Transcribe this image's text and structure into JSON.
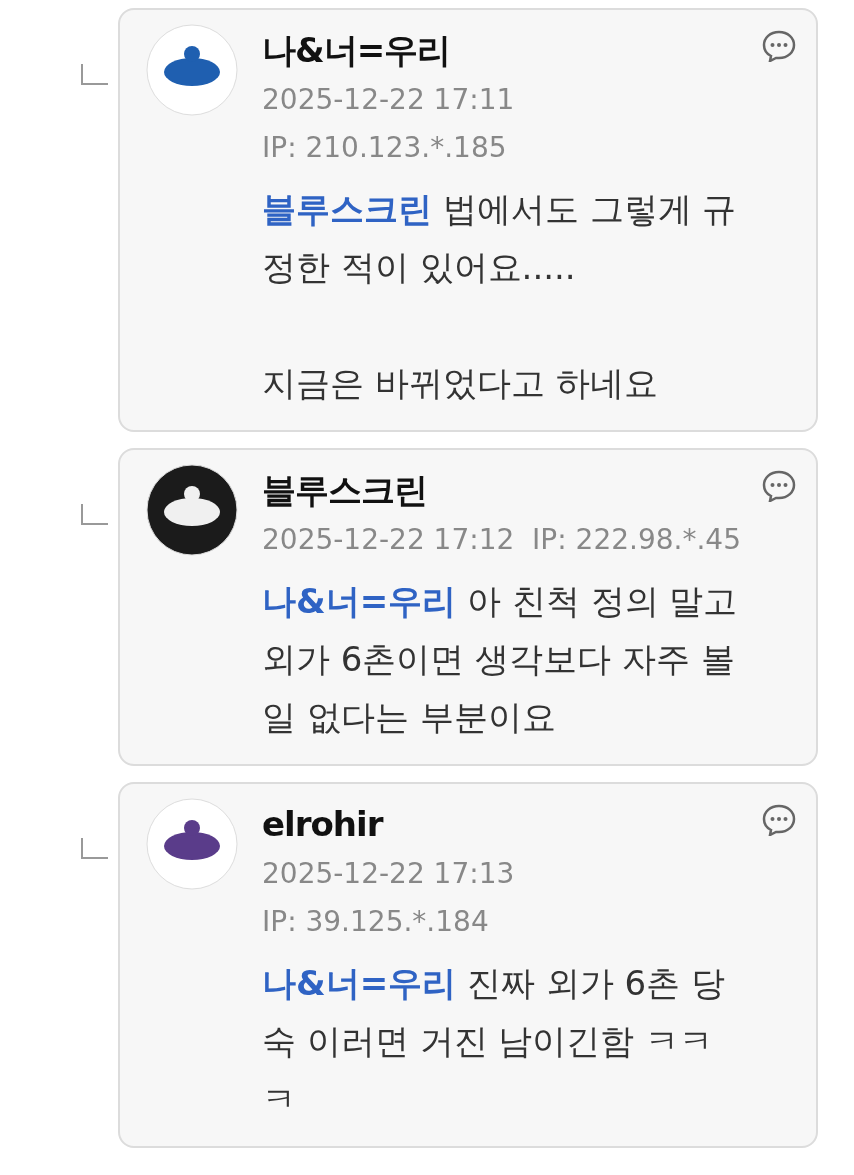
{
  "comments": [
    {
      "author": "나&너=우리",
      "meta": [
        "2025-12-22 17:11",
        "IP: 210.123.*.185"
      ],
      "mention": "블루스크린",
      "text": "법에서도 그렇게 규정한 적이 있어요.....\n\n지금은 바뀌었다고 하네요"
    },
    {
      "author": "블루스크린",
      "meta": [
        "2025-12-22 17:12  IP: 222.98.*.45"
      ],
      "mention": "나&너=우리",
      "text": "아 친척 정의 말고 외가 6촌이면 생각보다 자주 볼일 없다는 부분이요"
    },
    {
      "author": "elrohir",
      "meta": [
        "2025-12-22 17:13",
        "IP: 39.125.*.184"
      ],
      "mention": "나&너=우리",
      "text": "진짜 외가 6촌 당숙 이러면 거진 남이긴함 ㅋㅋㅋ"
    }
  ]
}
